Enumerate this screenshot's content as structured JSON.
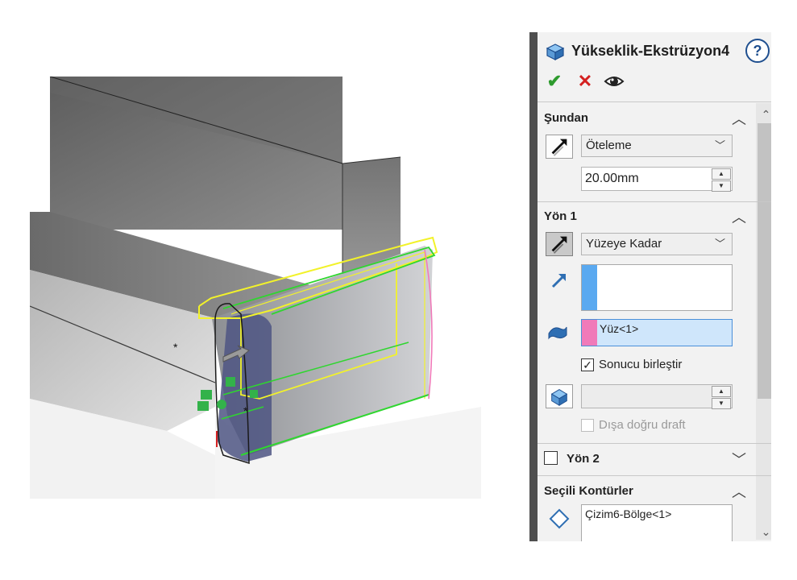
{
  "feature": {
    "title": "Yükseklik-Ekstrüzyon4",
    "help_label": "?",
    "ok_symbol": "✔",
    "cancel_symbol": "✕"
  },
  "from_group": {
    "header": "Şundan",
    "mode": "Öteleme",
    "offset_value": "20.00mm"
  },
  "direction1": {
    "header": "Yön 1",
    "end_condition": "Yüzeye Kadar",
    "direction_ref": "",
    "face_ref": "Yüz<1>",
    "face_swatch": "#f07ab9",
    "direction_swatch": "#5aa9f0",
    "merge_result_label": "Sonucu birleştir",
    "merge_result_checked": true,
    "draft_value": "",
    "draft_outward_label": "Dışa doğru draft"
  },
  "direction2": {
    "header": "Yön 2",
    "checked": false
  },
  "selected_contours": {
    "header": "Seçili Kontürler",
    "item": "Çizim6-Bölge<1>"
  },
  "colors": {
    "preview_yellow": "#f2f22a",
    "preview_green": "#2fd62f",
    "panel_border": "#4f4f4f",
    "accent_blue": "#1f4f8f"
  }
}
